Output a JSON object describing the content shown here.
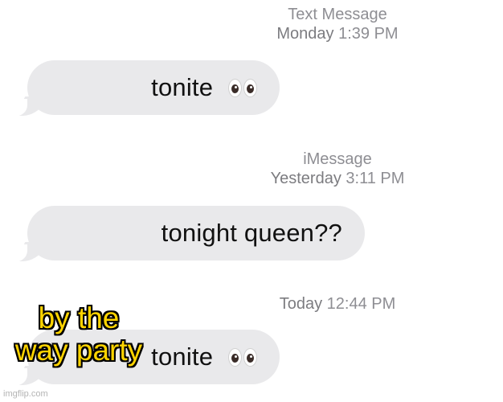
{
  "conversation": {
    "groups": [
      {
        "service": "Text Message",
        "day": "Monday",
        "time": "1:39 PM",
        "message": "tonite",
        "emoji": "eyes"
      },
      {
        "service": "iMessage",
        "day": "Yesterday",
        "time": "3:11 PM",
        "message": "tonight queen??"
      },
      {
        "day": "Today",
        "time": "12:44 PM",
        "message": "tonite",
        "emoji": "eyes"
      }
    ]
  },
  "caption": {
    "line1": "by the",
    "line2": "way party"
  },
  "watermark": "imgflip.com",
  "colors": {
    "bubble": "#e9e9eb",
    "timestamp": "#8e8e93",
    "caption_fill": "#ffd400",
    "caption_outline": "#000000"
  },
  "icons": [
    "eyes-emoji"
  ]
}
